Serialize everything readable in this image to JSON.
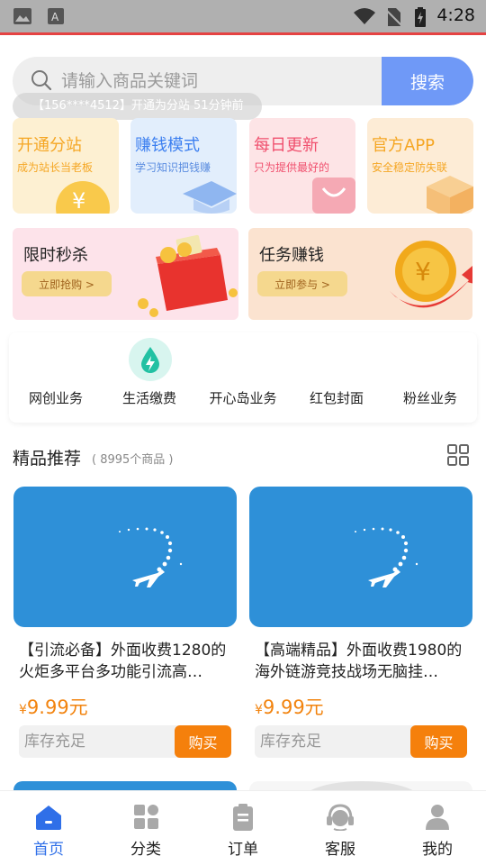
{
  "status_bar": {
    "time": "4:28",
    "icons": [
      "image-icon",
      "font-icon",
      "wifi-icon",
      "no-sim-icon",
      "battery-icon"
    ]
  },
  "search": {
    "placeholder": "请输入商品关键词",
    "button_label": "搜索"
  },
  "ticker": {
    "text": "【156****4512】开通为分站 51分钟前"
  },
  "feature_cards": [
    {
      "title": "开通分站",
      "subtitle": "成为站长当老板",
      "title_color": "#f5a623",
      "subtitle_color": "#f5a623",
      "bg": "#fdf0d2",
      "icon": "yen-coin-icon"
    },
    {
      "title": "赚钱模式",
      "subtitle": "学习知识把钱赚",
      "title_color": "#3c7ff0",
      "subtitle_color": "#5b8de0",
      "bg": "#e2eefc",
      "icon": "graduation-cap-icon"
    },
    {
      "title": "每日更新",
      "subtitle": "只为提供最好的",
      "title_color": "#f0506e",
      "subtitle_color": "#f0506e",
      "bg": "#fde4e6",
      "icon": "shopping-bag-icon"
    },
    {
      "title": "官方APP",
      "subtitle": "安全稳定防失联",
      "title_color": "#f5a623",
      "subtitle_color": "#f5a623",
      "bg": "#fdecd6",
      "icon": "box-icon"
    }
  ],
  "promos": [
    {
      "title": "限时秒杀",
      "button": "立即抢购 >",
      "bg": "#fde3ea",
      "icon": "red-envelope-box-icon"
    },
    {
      "title": "任务赚钱",
      "button": "立即参与 >",
      "bg": "#fbe3d0",
      "icon": "gold-coin-arrow-icon"
    }
  ],
  "services": [
    {
      "label": "网创业务",
      "icon": ""
    },
    {
      "label": "生活缴费",
      "icon": "water-drop-bolt-icon"
    },
    {
      "label": "开心岛业务",
      "icon": ""
    },
    {
      "label": "红包封面",
      "icon": ""
    },
    {
      "label": "粉丝业务",
      "icon": ""
    }
  ],
  "section": {
    "title": "精品推荐",
    "count": "( 8995个商品 )"
  },
  "products": [
    {
      "name": "【引流必备】外面收费1280的火炬多平台多功能引流高…",
      "currency": "¥",
      "price": "9.99元",
      "stock": "库存充足",
      "buy": "购买"
    },
    {
      "name": "【高端精品】外面收费1980的海外链游竞技战场无脑挂…",
      "currency": "¥",
      "price": "9.99元",
      "stock": "库存充足",
      "buy": "购买"
    }
  ],
  "tabs": [
    {
      "label": "首页",
      "icon": "home-icon",
      "active": true
    },
    {
      "label": "分类",
      "icon": "category-grid-icon",
      "active": false
    },
    {
      "label": "订单",
      "icon": "clipboard-icon",
      "active": false
    },
    {
      "label": "客服",
      "icon": "headset-icon",
      "active": false
    },
    {
      "label": "我的",
      "icon": "user-icon",
      "active": false
    }
  ],
  "colors": {
    "accent_blue": "#6f99f7",
    "active_tab": "#2f6fe8",
    "price_orange": "#f2830e",
    "buy_button": "#f5800c"
  }
}
